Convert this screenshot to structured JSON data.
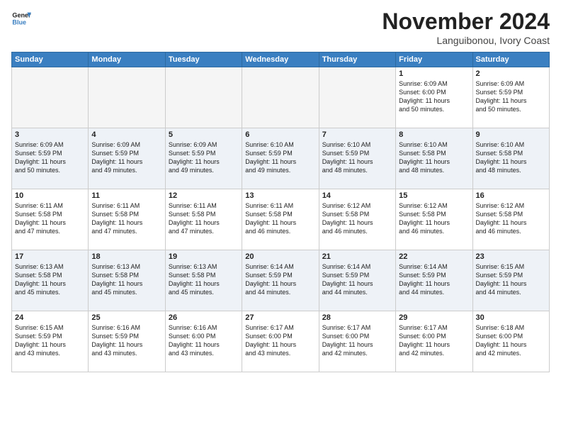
{
  "header": {
    "logo_line1": "General",
    "logo_line2": "Blue",
    "month_title": "November 2024",
    "subtitle": "Languibonou, Ivory Coast"
  },
  "weekdays": [
    "Sunday",
    "Monday",
    "Tuesday",
    "Wednesday",
    "Thursday",
    "Friday",
    "Saturday"
  ],
  "weeks": [
    [
      {
        "day": "",
        "info": ""
      },
      {
        "day": "",
        "info": ""
      },
      {
        "day": "",
        "info": ""
      },
      {
        "day": "",
        "info": ""
      },
      {
        "day": "",
        "info": ""
      },
      {
        "day": "1",
        "info": "Sunrise: 6:09 AM\nSunset: 6:00 PM\nDaylight: 11 hours\nand 50 minutes."
      },
      {
        "day": "2",
        "info": "Sunrise: 6:09 AM\nSunset: 5:59 PM\nDaylight: 11 hours\nand 50 minutes."
      }
    ],
    [
      {
        "day": "3",
        "info": "Sunrise: 6:09 AM\nSunset: 5:59 PM\nDaylight: 11 hours\nand 50 minutes."
      },
      {
        "day": "4",
        "info": "Sunrise: 6:09 AM\nSunset: 5:59 PM\nDaylight: 11 hours\nand 49 minutes."
      },
      {
        "day": "5",
        "info": "Sunrise: 6:09 AM\nSunset: 5:59 PM\nDaylight: 11 hours\nand 49 minutes."
      },
      {
        "day": "6",
        "info": "Sunrise: 6:10 AM\nSunset: 5:59 PM\nDaylight: 11 hours\nand 49 minutes."
      },
      {
        "day": "7",
        "info": "Sunrise: 6:10 AM\nSunset: 5:59 PM\nDaylight: 11 hours\nand 48 minutes."
      },
      {
        "day": "8",
        "info": "Sunrise: 6:10 AM\nSunset: 5:58 PM\nDaylight: 11 hours\nand 48 minutes."
      },
      {
        "day": "9",
        "info": "Sunrise: 6:10 AM\nSunset: 5:58 PM\nDaylight: 11 hours\nand 48 minutes."
      }
    ],
    [
      {
        "day": "10",
        "info": "Sunrise: 6:11 AM\nSunset: 5:58 PM\nDaylight: 11 hours\nand 47 minutes."
      },
      {
        "day": "11",
        "info": "Sunrise: 6:11 AM\nSunset: 5:58 PM\nDaylight: 11 hours\nand 47 minutes."
      },
      {
        "day": "12",
        "info": "Sunrise: 6:11 AM\nSunset: 5:58 PM\nDaylight: 11 hours\nand 47 minutes."
      },
      {
        "day": "13",
        "info": "Sunrise: 6:11 AM\nSunset: 5:58 PM\nDaylight: 11 hours\nand 46 minutes."
      },
      {
        "day": "14",
        "info": "Sunrise: 6:12 AM\nSunset: 5:58 PM\nDaylight: 11 hours\nand 46 minutes."
      },
      {
        "day": "15",
        "info": "Sunrise: 6:12 AM\nSunset: 5:58 PM\nDaylight: 11 hours\nand 46 minutes."
      },
      {
        "day": "16",
        "info": "Sunrise: 6:12 AM\nSunset: 5:58 PM\nDaylight: 11 hours\nand 46 minutes."
      }
    ],
    [
      {
        "day": "17",
        "info": "Sunrise: 6:13 AM\nSunset: 5:58 PM\nDaylight: 11 hours\nand 45 minutes."
      },
      {
        "day": "18",
        "info": "Sunrise: 6:13 AM\nSunset: 5:58 PM\nDaylight: 11 hours\nand 45 minutes."
      },
      {
        "day": "19",
        "info": "Sunrise: 6:13 AM\nSunset: 5:58 PM\nDaylight: 11 hours\nand 45 minutes."
      },
      {
        "day": "20",
        "info": "Sunrise: 6:14 AM\nSunset: 5:59 PM\nDaylight: 11 hours\nand 44 minutes."
      },
      {
        "day": "21",
        "info": "Sunrise: 6:14 AM\nSunset: 5:59 PM\nDaylight: 11 hours\nand 44 minutes."
      },
      {
        "day": "22",
        "info": "Sunrise: 6:14 AM\nSunset: 5:59 PM\nDaylight: 11 hours\nand 44 minutes."
      },
      {
        "day": "23",
        "info": "Sunrise: 6:15 AM\nSunset: 5:59 PM\nDaylight: 11 hours\nand 44 minutes."
      }
    ],
    [
      {
        "day": "24",
        "info": "Sunrise: 6:15 AM\nSunset: 5:59 PM\nDaylight: 11 hours\nand 43 minutes."
      },
      {
        "day": "25",
        "info": "Sunrise: 6:16 AM\nSunset: 5:59 PM\nDaylight: 11 hours\nand 43 minutes."
      },
      {
        "day": "26",
        "info": "Sunrise: 6:16 AM\nSunset: 6:00 PM\nDaylight: 11 hours\nand 43 minutes."
      },
      {
        "day": "27",
        "info": "Sunrise: 6:17 AM\nSunset: 6:00 PM\nDaylight: 11 hours\nand 43 minutes."
      },
      {
        "day": "28",
        "info": "Sunrise: 6:17 AM\nSunset: 6:00 PM\nDaylight: 11 hours\nand 42 minutes."
      },
      {
        "day": "29",
        "info": "Sunrise: 6:17 AM\nSunset: 6:00 PM\nDaylight: 11 hours\nand 42 minutes."
      },
      {
        "day": "30",
        "info": "Sunrise: 6:18 AM\nSunset: 6:00 PM\nDaylight: 11 hours\nand 42 minutes."
      }
    ]
  ]
}
